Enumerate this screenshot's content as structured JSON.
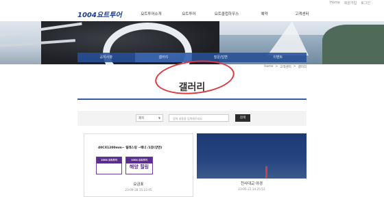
{
  "top_links": [
    "Home",
    "회원가입",
    "로그인"
  ],
  "logo": {
    "num": "1004",
    "text": "요트투어"
  },
  "gnb": [
    "요트투어소개",
    "요트투어",
    "요트클럽하우스",
    "예약",
    "고객센터"
  ],
  "subnav": {
    "tabs": [
      "공지사항",
      "갤러리",
      "질문/답변",
      "이벤트"
    ],
    "active_index": 1
  },
  "breadcrumb": [
    "Home",
    ">",
    "고객센터",
    ">",
    "갤러리"
  ],
  "page_title": "갤러리",
  "search": {
    "select_value": "제목",
    "placeholder": "검색 내용을 입력해주세요",
    "button_label": "검색"
  },
  "cards": [
    {
      "thumb_text": "40CX1200mm~ 릴레스팅 ~배너 /1장(양면)",
      "sign1": {
        "band": "1004 요트투어",
        "big": "",
        "small": ""
      },
      "sign2": {
        "band": "1004 요트투어",
        "big": "해양 힐링",
        "small": ""
      },
      "title": "요금표",
      "date": "23-09-28 15:23:45"
    },
    {
      "title": "천사대교 야경",
      "date": "23-05-21 14:25:51"
    }
  ],
  "colors": {
    "brand": "#1a3b8f",
    "subnav": "#2650a0",
    "annotation": "#e0383e",
    "title_line": "#2e5aa8"
  }
}
